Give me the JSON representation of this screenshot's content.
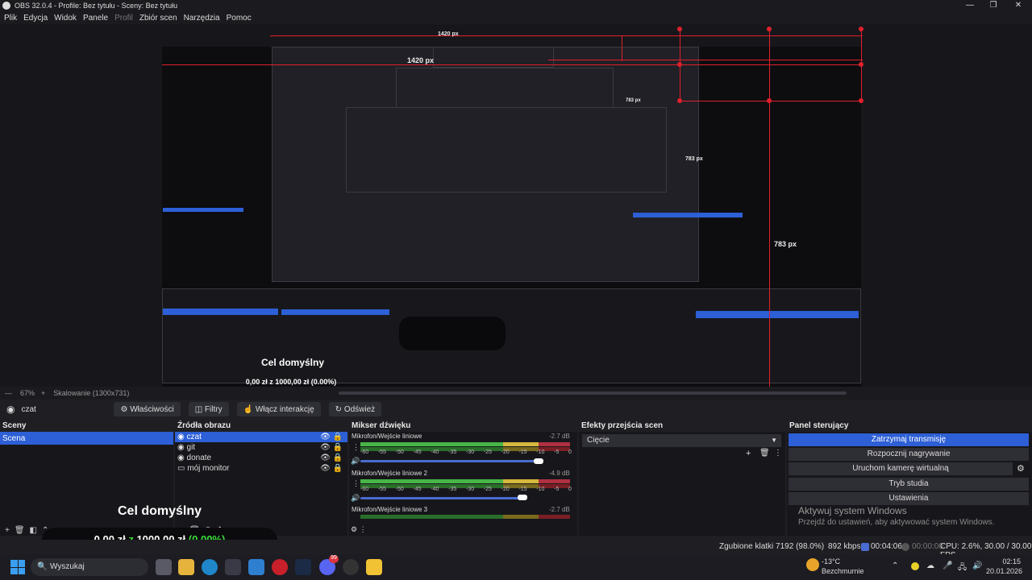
{
  "window": {
    "title": "OBS 32.0.4 - Profile: Bez tytułu - Sceny: Bez tytułu",
    "minimize": "—",
    "maximize": "❐",
    "close": "✕"
  },
  "menu": {
    "items": [
      "Plik",
      "Edycja",
      "Widok",
      "Panele",
      "Profil",
      "Zbiór scen",
      "Narzędzia",
      "Pomoc"
    ]
  },
  "preview": {
    "labels": [
      "1420 px",
      "1420 px",
      "783 px",
      "783 px",
      "783 px"
    ],
    "nested_title": "Cel domyślny",
    "nested_progress": "0,00 zł z 1000,00 zł (0.00%)"
  },
  "preview_bar": {
    "zoom": "67%",
    "scaling": "Skalowanie (1300x731)"
  },
  "toolbar": {
    "source_name": "czat",
    "properties": "Właściwości",
    "filters": "Filtry",
    "interact": "Włącz interakcję",
    "refresh": "Odśwież"
  },
  "scenes": {
    "header": "Sceny",
    "items": [
      "Scena"
    ]
  },
  "sources": {
    "header": "Źródła obrazu",
    "items": [
      "czat",
      "git",
      "donate",
      "mój monitor"
    ]
  },
  "mixer": {
    "header": "Mikser dźwięku",
    "channels": [
      {
        "name": "Mikrofon/Wejście liniowe",
        "db": "-2.7 dB"
      },
      {
        "name": "Mikrofon/Wejście liniowe 2",
        "db": "-4.9 dB"
      },
      {
        "name": "Mikrofon/Wejście liniowe 3",
        "db": "-2.7 dB"
      }
    ],
    "scale": [
      "-60",
      "-55",
      "-50",
      "-45",
      "-40",
      "-35",
      "-30",
      "-25",
      "-20",
      "-15",
      "-10",
      "-5",
      "0"
    ]
  },
  "transitions": {
    "header": "Efekty przejścia scen",
    "selected": "Cięcie"
  },
  "controls": {
    "header": "Panel sterujący",
    "stop_stream": "Zatrzymaj transmisję",
    "start_record": "Rozpocznij nagrywanie",
    "virtual_cam": "Uruchom kamerę wirtualną",
    "studio": "Tryb studia",
    "settings": "Ustawienia",
    "watermark_1": "Aktywuj system Windows",
    "watermark_2": "Przejdź do ustawień, aby aktywować system Windows."
  },
  "overlay": {
    "goal_title": "Cel domyślny",
    "goal_current": "0,00 zł",
    "goal_z": "z",
    "goal_target": "1000,00 zł",
    "goal_percent": "(0.00%)"
  },
  "status": {
    "frames": "Zgubione klatki 7192 (98.0%)",
    "bitrate": "892 kbps",
    "stream_time": "00:04:06",
    "rec_time": "00:00:00",
    "cpu": "CPU: 2.6%, 30.00 / 30.00 FPS"
  },
  "taskbar": {
    "search": "Wyszukaj",
    "badge": "99",
    "temp": "-13°C",
    "weather": "Bezchmurnie",
    "time": "02:15",
    "date": "20.01.2026"
  },
  "colors": {
    "accent": "#2d5fd6",
    "guide_red": "#e0202c",
    "meter_green": "#47b547",
    "meter_yellow": "#d6b83c",
    "meter_red": "#b03040",
    "goal_green": "#3adf3a"
  }
}
